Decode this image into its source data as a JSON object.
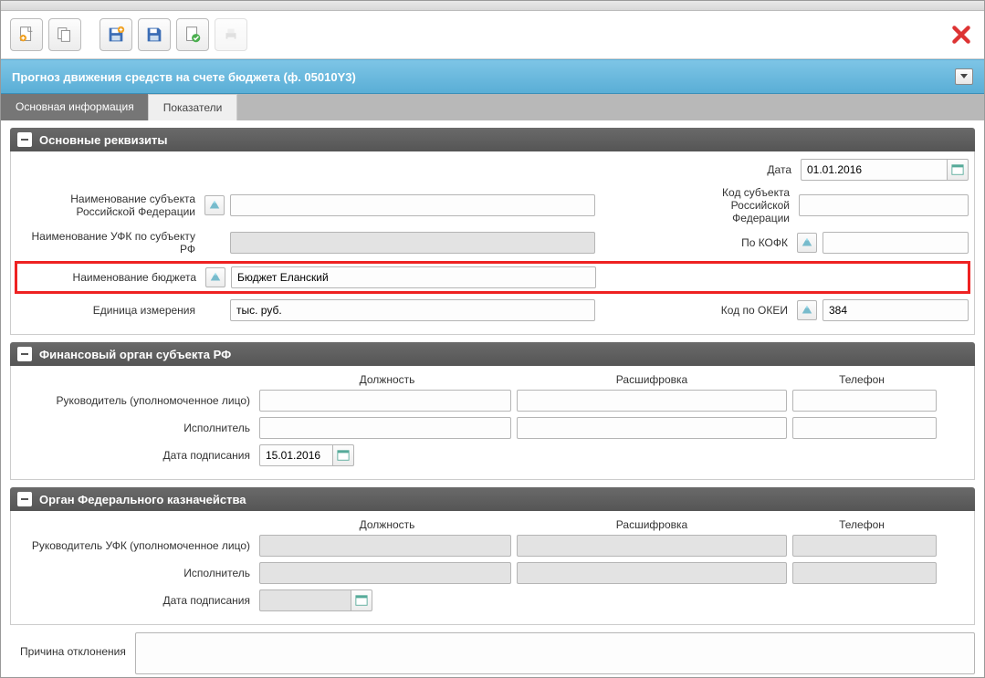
{
  "header": {
    "title": "Прогноз движения средств на счете бюджета (ф. 05010Y3)"
  },
  "tabs": {
    "active": "Основная информация",
    "inactive": "Показатели"
  },
  "sections": {
    "main": {
      "title": "Основные реквизиты"
    },
    "fin": {
      "title": "Финансовый орган субъекта РФ"
    },
    "fk": {
      "title": "Орган Федерального казначейства"
    }
  },
  "labels": {
    "date": "Дата",
    "subject_name": "Наименование субъекта Российской Федерации",
    "subject_code": "Код субъекта Российской Федерации",
    "ufk_name": "Наименование УФК по субъекту РФ",
    "kofk": "По КОФК",
    "budget_name": "Наименование бюджета",
    "unit": "Единица измерения",
    "okei": "Код по ОКЕИ",
    "position": "Должность",
    "fullname": "Расшифровка",
    "phone": "Телефон",
    "head": "Руководитель (уполномоченное лицо)",
    "executor": "Исполнитель",
    "sign_date": "Дата подписания",
    "head_ufk": "Руководитель УФК (уполномоченное лицо)",
    "reject_reason": "Причина отклонения"
  },
  "values": {
    "date": "01.01.2016",
    "subject_name": "",
    "subject_code": "",
    "ufk_name": "",
    "kofk": "",
    "budget_name": "Бюджет Еланский",
    "unit": "тыс. руб.",
    "okei": "384",
    "fin_sign_date": "15.01.2016",
    "fk_sign_date": "",
    "reject_reason": ""
  }
}
